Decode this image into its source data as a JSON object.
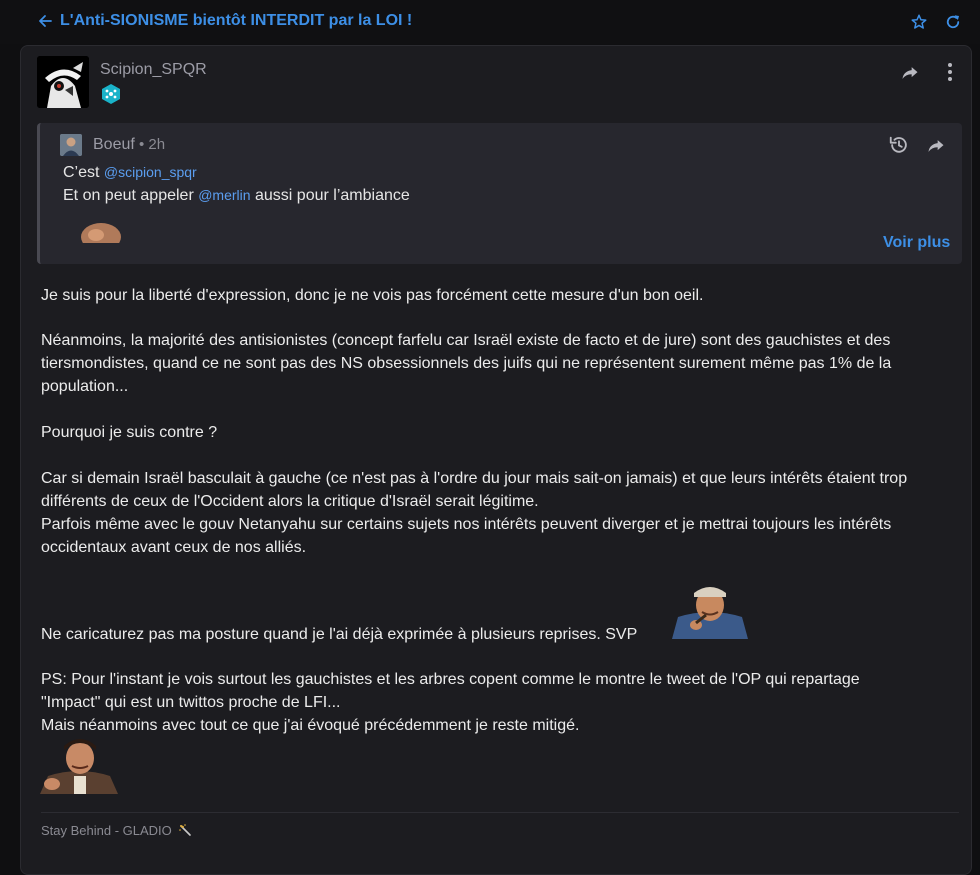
{
  "header": {
    "title": "L'Anti-SIONISME bientôt INTERDIT par la LOI !",
    "back_icon": "arrow-left-icon",
    "favorite_icon": "star-icon",
    "refresh_icon": "refresh-icon"
  },
  "post": {
    "author": "Scipion_SPQR",
    "badge_icon": "cyan-badge-icon",
    "quote": {
      "author": "Boeuf",
      "separator": " • ",
      "time": "2h",
      "line1_prefix": "C’est ",
      "line1_mention": "@scipion_spqr",
      "line2_prefix": "Et on peut appeler ",
      "line2_mention": "@merlin",
      "line2_suffix": " aussi pour l’ambiance",
      "more_label": "Voir plus"
    },
    "paragraphs": [
      "Je suis pour la liberté d'expression, donc je ne vois pas forcément cette mesure d'un bon oeil.",
      "Néanmoins, la majorité des antisionistes (concept farfelu car Israël existe de facto et de jure) sont des gauchistes et des",
      "tiersmondistes, quand ce ne sont pas des NS obsessionnels des juifs qui ne représentent surement même pas 1% de la",
      "population...",
      "Pourquoi je suis contre ?",
      "Car si demain Israël basculait à gauche (ce n'est pas à l'ordre du jour mais sait-on jamais) et que leurs intérêts étaient trop",
      "différents de ceux de l'Occident alors la critique d'Israël serait légitime.",
      "Parfois même avec le gouv Netanyahu sur certains sujets nos intérêts peuvent diverger et je mettrai toujours les intérêts",
      "occidentaux avant ceux de nos alliés.",
      "Ne caricaturez pas ma posture quand je l'ai déjà exprimée à plusieurs reprises. SVP",
      "PS: Pour l'instant je vois surtout les gauchistes et les arbres copent comme le montre le tweet de l'OP qui repartage",
      "\"Impact\" qui est un twittos proche de LFI...",
      "Mais néanmoins avec tout ce que j'ai évoqué précédemment je reste mitigé."
    ],
    "signature": "Stay Behind - GLADIO"
  },
  "colors": {
    "accent": "#3d8fe6",
    "mention": "#5b9ef0",
    "background": "#0f0f11",
    "card": "#1c1c20",
    "quote_bg": "#27272e",
    "badge": "#19b3c9"
  }
}
